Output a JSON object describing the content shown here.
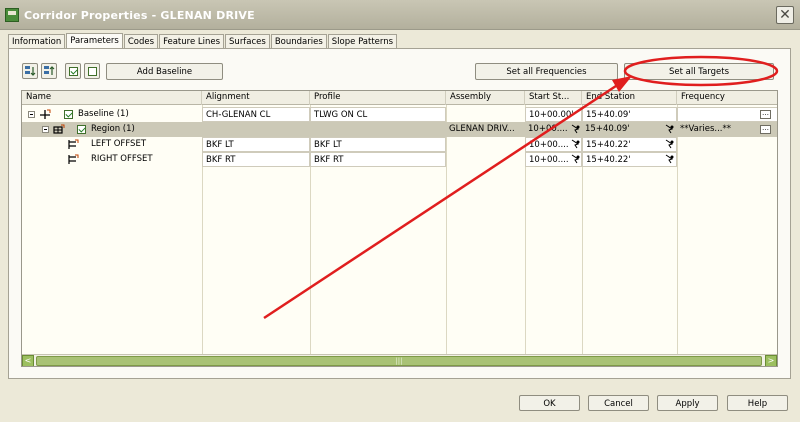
{
  "window": {
    "title": "Corridor Properties - GLENAN DRIVE",
    "close_glyph": "✕"
  },
  "tabs": [
    {
      "label": "Information"
    },
    {
      "label": "Parameters"
    },
    {
      "label": "Codes"
    },
    {
      "label": "Feature Lines"
    },
    {
      "label": "Surfaces"
    },
    {
      "label": "Boundaries"
    },
    {
      "label": "Slope Patterns"
    }
  ],
  "toolbar": {
    "add_baseline": "Add Baseline",
    "set_all_frequencies": "Set all Frequencies",
    "set_all_targets": "Set all Targets"
  },
  "grid": {
    "columns": [
      "Name",
      "Alignment",
      "Profile",
      "Assembly",
      "Start St...",
      "End Station",
      "Frequency"
    ],
    "rows": [
      {
        "name": "Baseline (1)",
        "alignment": "CH-GLENAN CL",
        "profile": "TLWG ON CL",
        "assembly": "",
        "start": "10+00.00'",
        "end": "15+40.09'",
        "frequency": ""
      },
      {
        "name": "Region (1)",
        "alignment": "",
        "profile": "",
        "assembly": "GLENAN DRIV...",
        "start": "10+00....",
        "end": "15+40.09'",
        "frequency": "**Varies...**"
      },
      {
        "name": "LEFT OFFSET",
        "alignment": "BKF LT",
        "profile": "BKF LT",
        "assembly": "",
        "start": "10+00....",
        "end": "15+40.22'",
        "frequency": ""
      },
      {
        "name": "RIGHT OFFSET",
        "alignment": "BKF RT",
        "profile": "BKF RT",
        "assembly": "",
        "start": "10+00....",
        "end": "15+40.22'",
        "frequency": ""
      }
    ]
  },
  "scrollbar": {
    "left_arrow": "<",
    "right_arrow": ">",
    "thumb_grip": "|||"
  },
  "footer": {
    "ok": "OK",
    "cancel": "Cancel",
    "apply": "Apply",
    "help": "Help"
  },
  "colors": {
    "annotation_red": "#e01e1e",
    "scrollbar_green": "#a9c275",
    "selected_row": "#ccc9b7"
  }
}
